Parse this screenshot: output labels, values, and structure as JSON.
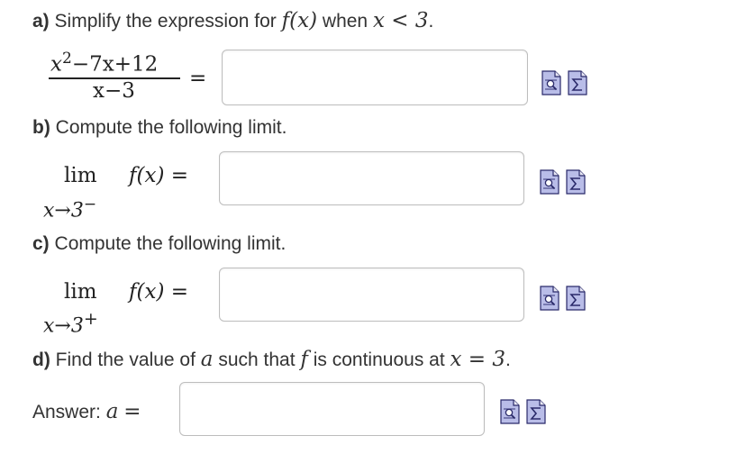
{
  "parts": {
    "a": {
      "label": "a)",
      "prompt_pre": "Simplify the expression for ",
      "prompt_fx": "f(x)",
      "prompt_mid": " when ",
      "prompt_cond": "x < 3",
      "prompt_end": ".",
      "numerator": "x",
      "numerator_exp": "2",
      "numerator_rest": "−7x+12",
      "denominator": "x−3",
      "equals": "=",
      "answer_value": ""
    },
    "b": {
      "label": "b)",
      "prompt": "Compute the following limit.",
      "lim": "lim",
      "func": "f(x)",
      "equals": "=",
      "sub_var": "x→3",
      "sub_sign": "−",
      "answer_value": ""
    },
    "c": {
      "label": "c)",
      "prompt": "Compute the following limit.",
      "lim": "lim",
      "func": "f(x)",
      "equals": "=",
      "sub_var": "x→3",
      "sub_sign": "+",
      "answer_value": ""
    },
    "d": {
      "label": "d)",
      "prompt_pre": "Find the value of ",
      "prompt_a": "a",
      "prompt_mid": " such that ",
      "prompt_f": "f",
      "prompt_mid2": " is continuous at ",
      "prompt_cond": "x = 3",
      "prompt_end": ".",
      "answer_label": "Answer: ",
      "answer_var": "a",
      "equals": "=",
      "answer_value": ""
    }
  },
  "icons": {
    "preview": "preview-icon",
    "equation_editor": "sigma-icon",
    "icon_fill": "#b9bde8",
    "icon_border": "#2a2a6a"
  }
}
